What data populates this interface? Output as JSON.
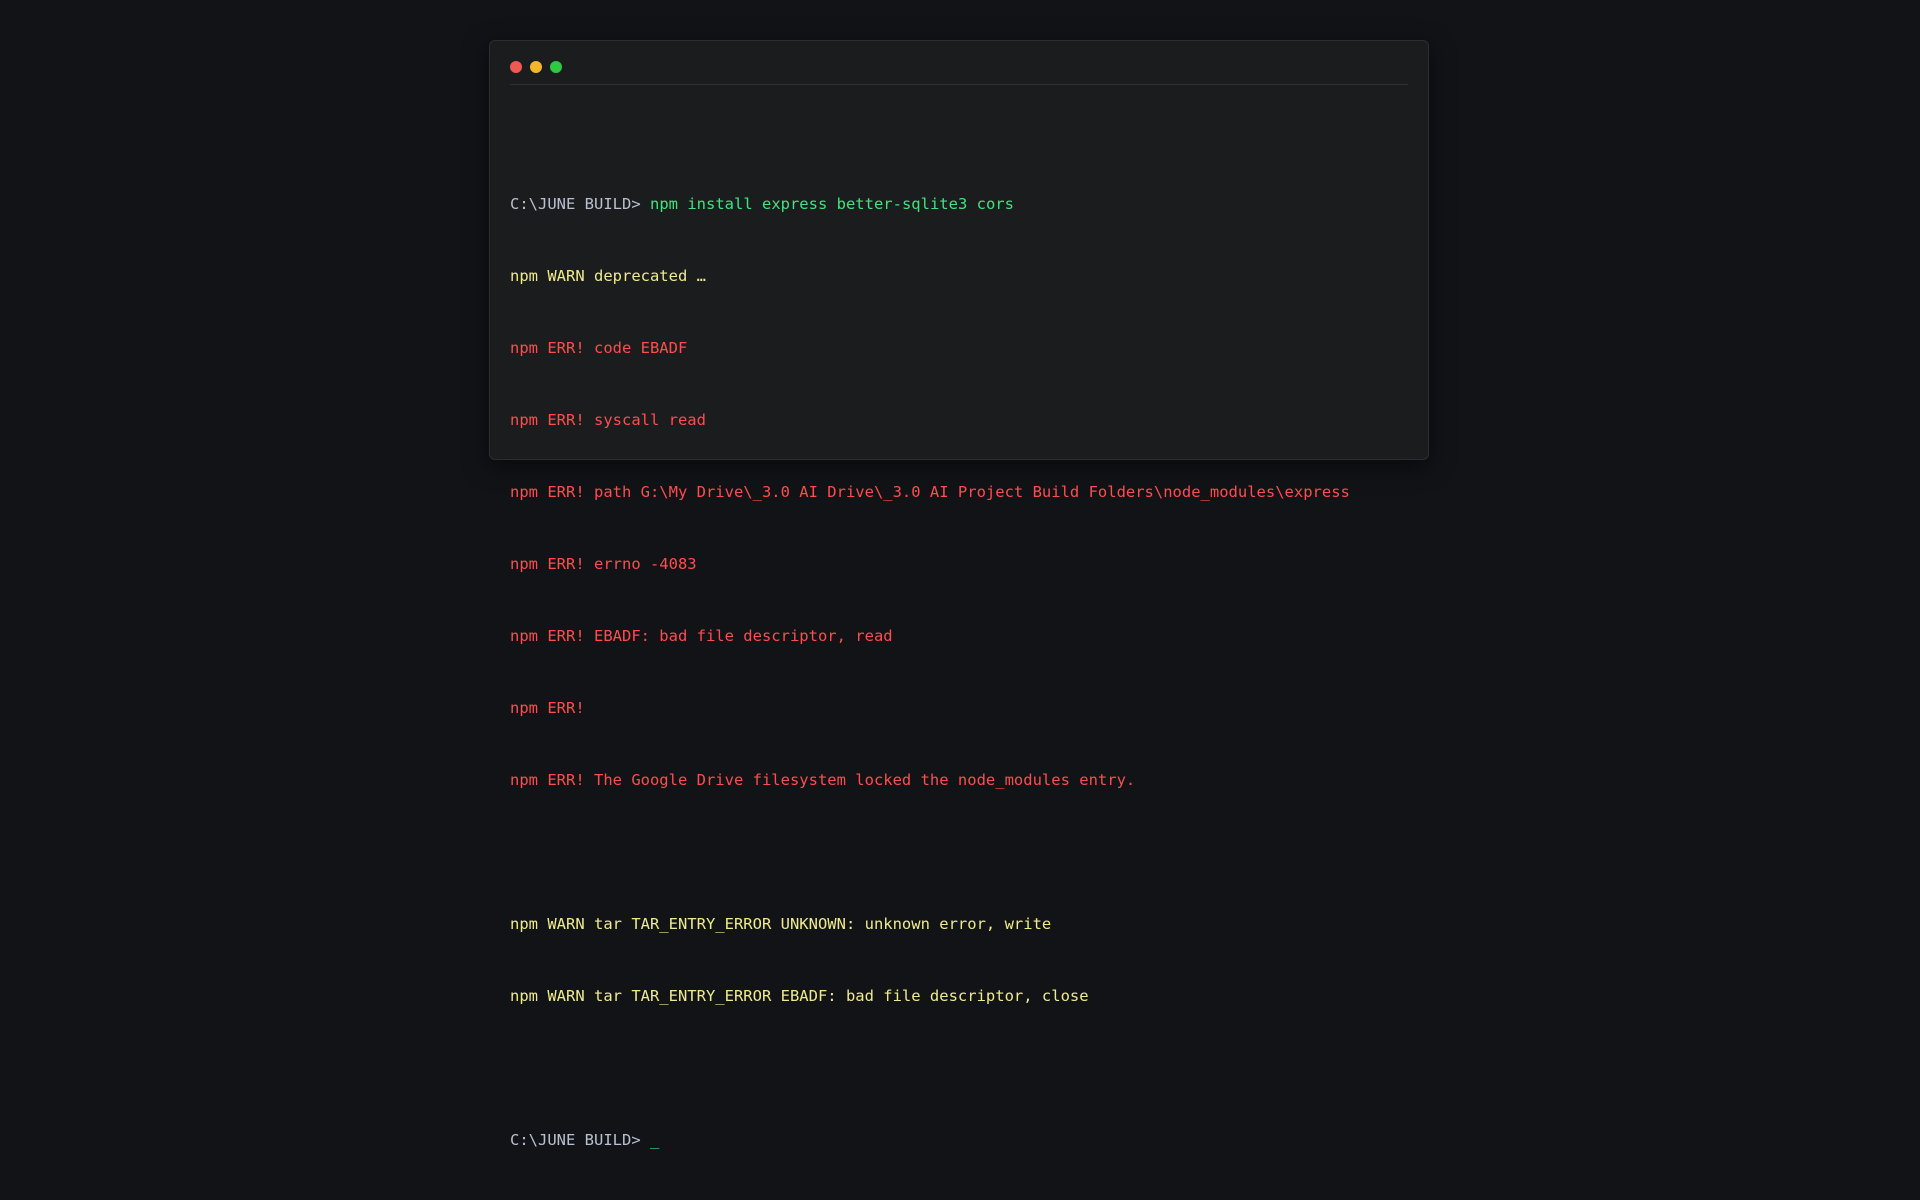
{
  "window": {
    "controls": [
      "close",
      "minimize",
      "maximize"
    ]
  },
  "terminal": {
    "prompt": "C:\\JUNE BUILD>",
    "command": "npm install express better-sqlite3 cors",
    "lines": [
      {
        "type": "warn",
        "text": "npm WARN deprecated …"
      },
      {
        "type": "err",
        "text": "npm ERR! code EBADF"
      },
      {
        "type": "err",
        "text": "npm ERR! syscall read"
      },
      {
        "type": "err",
        "text": "npm ERR! path G:\\My Drive\\_3.0 AI Drive\\_3.0 AI Project Build Folders\\node_modules\\express"
      },
      {
        "type": "err",
        "text": "npm ERR! errno -4083"
      },
      {
        "type": "err",
        "text": "npm ERR! EBADF: bad file descriptor, read"
      },
      {
        "type": "err",
        "text": "npm ERR!"
      },
      {
        "type": "err",
        "text": "npm ERR! The Google Drive filesystem locked the node_modules entry."
      },
      {
        "type": "blank",
        "text": ""
      },
      {
        "type": "warn",
        "text": "npm WARN tar TAR_ENTRY_ERROR UNKNOWN: unknown error, write"
      },
      {
        "type": "warn",
        "text": "npm WARN tar TAR_ENTRY_ERROR EBADF: bad file descriptor, close"
      },
      {
        "type": "blank",
        "text": ""
      }
    ],
    "final_prompt": "C:\\JUNE BUILD>",
    "cursor": "_"
  },
  "colors": {
    "background": "#111317",
    "window": "#1b1c1e",
    "prompt": "#b9c0d0",
    "command": "#42e37d",
    "warn": "#f0eb8c",
    "error": "#ff4d4d"
  }
}
